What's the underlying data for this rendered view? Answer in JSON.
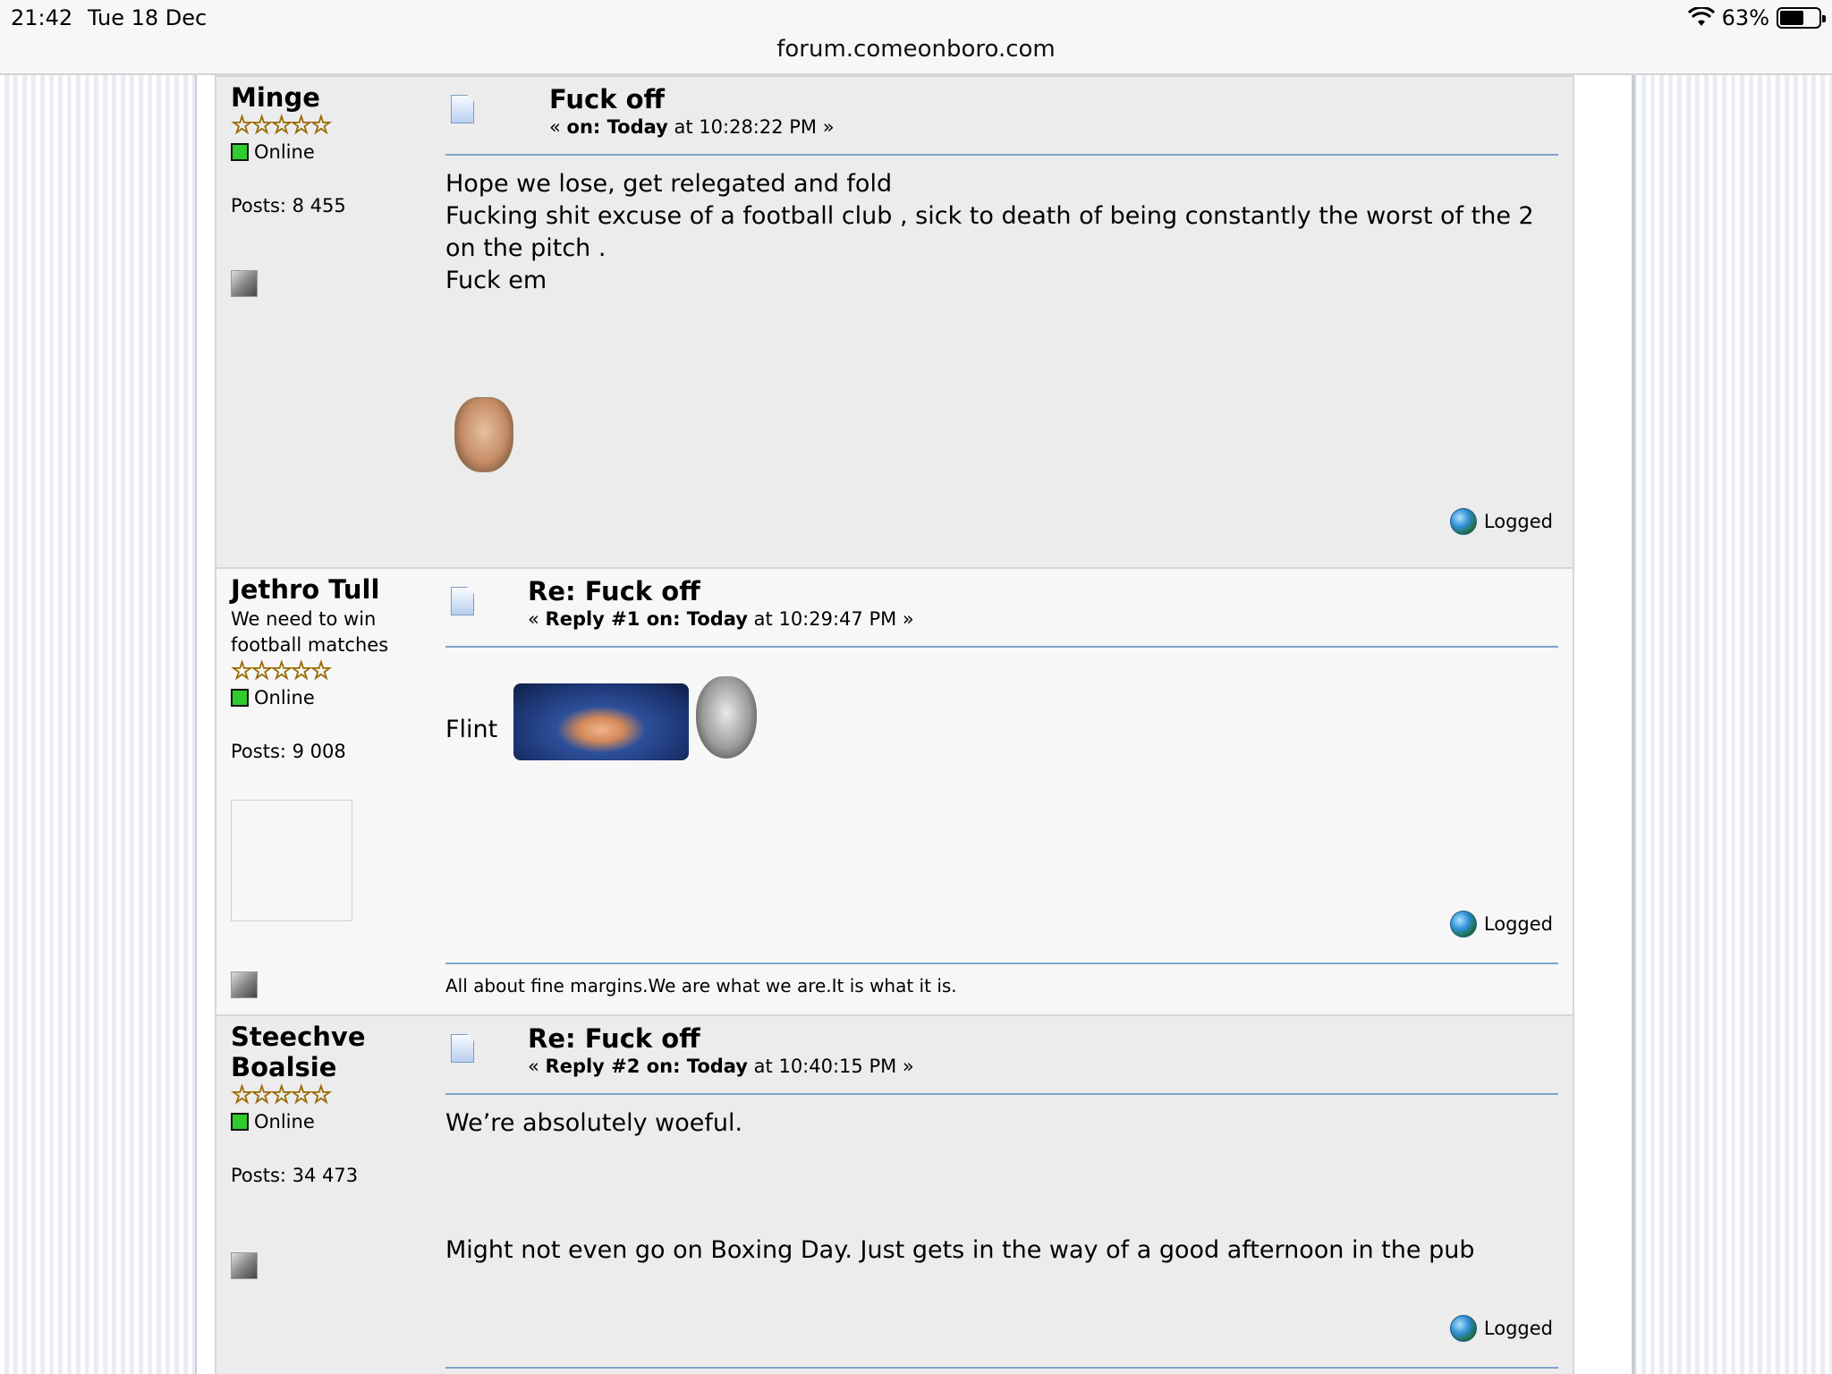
{
  "status_bar": {
    "time": "21:42",
    "date": "Tue 18 Dec",
    "battery": "63%",
    "battery_level": 0.63
  },
  "browser": {
    "url": "forum.comeonboro.com"
  },
  "posts": [
    {
      "author": "Minge",
      "title_text": "",
      "stars": "☆☆☆☆☆",
      "online": "Online",
      "posts": "Posts: 8 455",
      "subject": "Fuck off",
      "meta_prefix": "« ",
      "meta_bold": "on: Today",
      "meta_time": " at 10:28:22 PM »",
      "body": [
        "Hope we lose, get relegated and fold",
        "Fucking shit excuse of a football club , sick to death of being constantly the worst of the 2 on the pitch .",
        "Fuck em"
      ],
      "logged": "Logged"
    },
    {
      "author": "Jethro Tull",
      "title_text": "We need to win football matches",
      "stars": "☆☆☆☆☆",
      "online": "Online",
      "posts": "Posts: 9 008",
      "subject": "Re: Fuck off",
      "meta_prefix": "« ",
      "meta_bold": "Reply #1 on: Today",
      "meta_time": " at 10:29:47 PM »",
      "body": [
        "Flint"
      ],
      "logged": "Logged",
      "signature": "All about fine margins.We are what we are.It is what it is."
    },
    {
      "author": "Steechve Boalsie",
      "title_text": "",
      "stars": "☆☆☆☆☆",
      "online": "Online",
      "posts": "Posts: 34 473",
      "subject": "Re: Fuck off",
      "meta_prefix": "« ",
      "meta_bold": "Reply #2 on: Today",
      "meta_time": " at 10:40:15 PM »",
      "body": [
        "We’re absolutely woeful.",
        "Might not even go on Boxing Day. Just gets in the way of a good afternoon in the pub"
      ],
      "logged": "Logged"
    }
  ]
}
